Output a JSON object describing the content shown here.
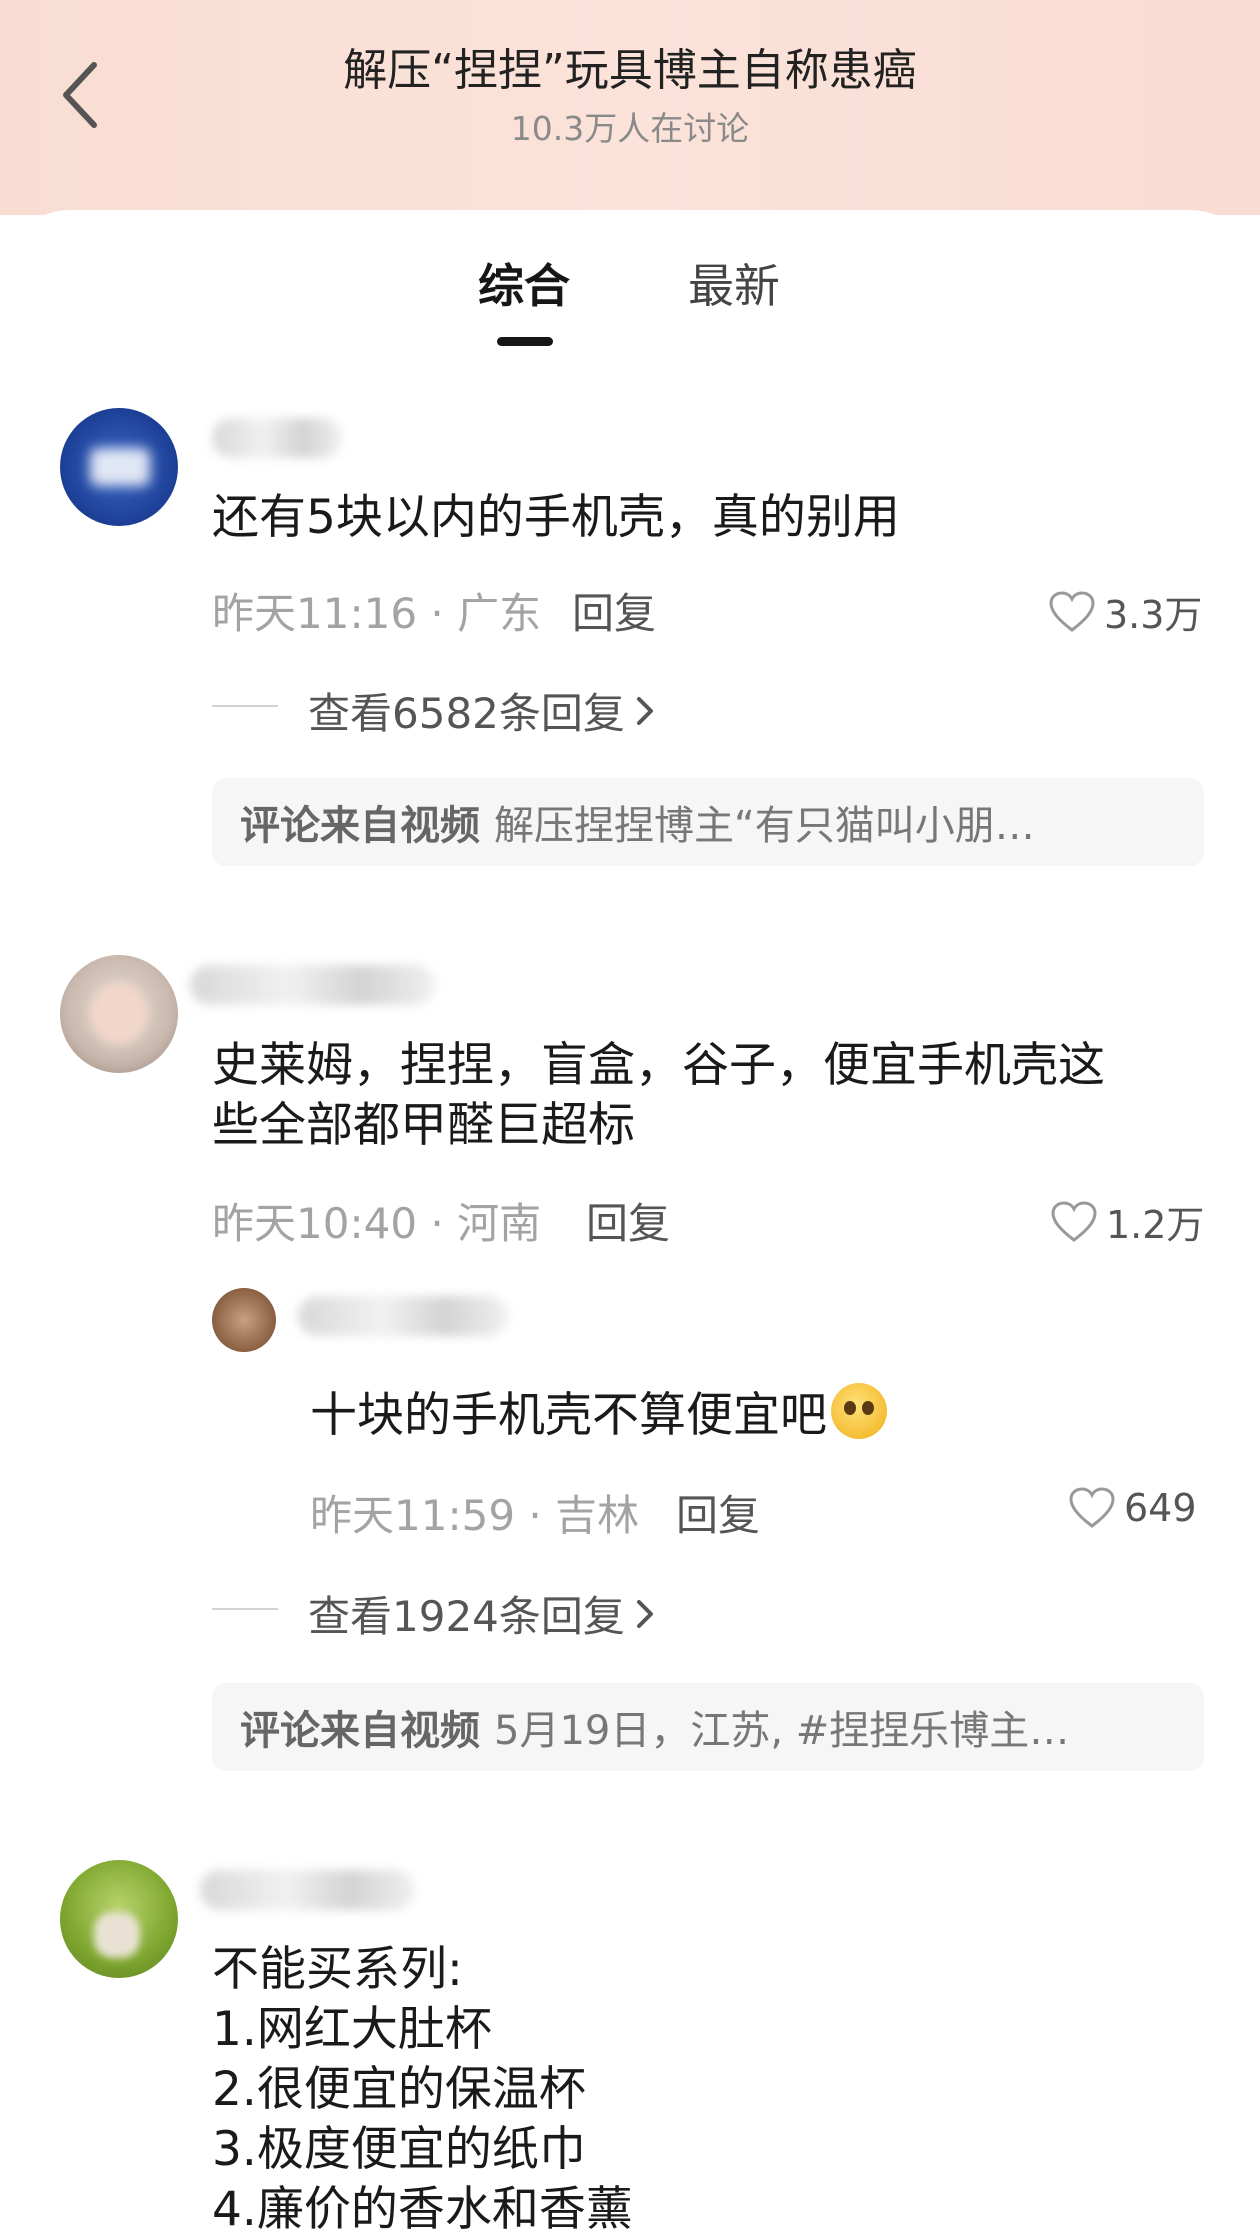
{
  "header": {
    "title": "解压“捏捏”玩具博主自称患癌",
    "subtitle": "10.3万人在讨论"
  },
  "tabs": [
    {
      "label": "综合",
      "active": true
    },
    {
      "label": "最新",
      "active": false
    }
  ],
  "comments": [
    {
      "text": "还有5块以内的手机壳，真的别用",
      "meta": "昨天11:16 · 广东",
      "reply_label": "回复",
      "likes": "3.3万",
      "view_replies": "查看6582条回复",
      "source_label": "评论来自视频",
      "source_text": "解压捏捏博主“有只猫叫小朋…"
    },
    {
      "text_line1": "史莱姆，捏捏，盲盒，谷子，便宜手机壳这",
      "text_line2": "些全部都甲醛巨超标",
      "meta": "昨天10:40 · 河南",
      "reply_label": "回复",
      "likes": "1.2万",
      "sub_reply": {
        "text": "十块的手机壳不算便宜吧",
        "meta": "昨天11:59 · 吉林",
        "reply_label": "回复",
        "likes": "649"
      },
      "view_replies": "查看1924条回复",
      "source_label": "评论来自视频",
      "source_text": "5月19日，江苏, #捏捏乐博主…"
    },
    {
      "lines": [
        "不能买系列:",
        "1.网红大肚杯",
        "2.很便宜的保温杯",
        "3.极度便宜的纸巾",
        "4.廉价的香水和香薰"
      ]
    }
  ],
  "colors": {
    "header_bg": "#f9ddd3",
    "meta_gray": "#a3a3a3",
    "source_bg": "#f6f6f6"
  }
}
